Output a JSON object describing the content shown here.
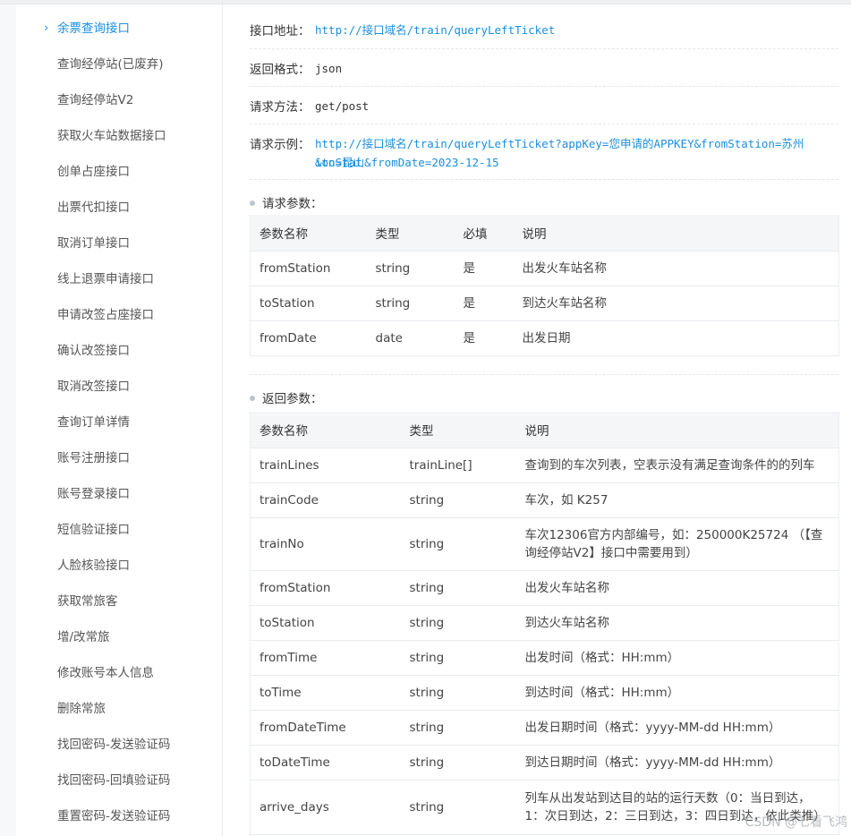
{
  "sidebar": {
    "items": [
      {
        "label": "余票查询接口",
        "active": true
      },
      {
        "label": "查询经停站(已废弃)"
      },
      {
        "label": "查询经停站V2"
      },
      {
        "label": "获取火车站数据接口"
      },
      {
        "label": "创单占座接口"
      },
      {
        "label": "出票代扣接口"
      },
      {
        "label": "取消订单接口"
      },
      {
        "label": "线上退票申请接口"
      },
      {
        "label": "申请改签占座接口"
      },
      {
        "label": "确认改签接口"
      },
      {
        "label": "取消改签接口"
      },
      {
        "label": "查询订单详情"
      },
      {
        "label": "账号注册接口"
      },
      {
        "label": "账号登录接口"
      },
      {
        "label": "短信验证接口"
      },
      {
        "label": "人脸核验接口"
      },
      {
        "label": "获取常旅客"
      },
      {
        "label": "增/改常旅"
      },
      {
        "label": "修改账号本人信息"
      },
      {
        "label": "删除常旅"
      },
      {
        "label": "找回密码-发送验证码"
      },
      {
        "label": "找回密码-回填验证码"
      },
      {
        "label": "重置密码-发送验证码"
      }
    ]
  },
  "info": {
    "address_label": "接口地址：",
    "address_value": "http://接口域名/train/queryLeftTicket",
    "format_label": "返回格式：",
    "format_value": "json",
    "method_label": "请求方法：",
    "method_value": "get/post",
    "example_label": "请求示例：",
    "example_line1": "http://接口域名/train/queryLeftTicket?appKey=您申请的APPKEY&fromStation=苏州&toStat",
    "example_line2": "ion=昆山&fromDate=2023-12-15"
  },
  "request_params": {
    "title": "请求参数：",
    "headers": [
      "参数名称",
      "类型",
      "必填",
      "说明"
    ],
    "rows": [
      [
        "fromStation",
        "string",
        "是",
        "出发火车站名称"
      ],
      [
        "toStation",
        "string",
        "是",
        "到达火车站名称"
      ],
      [
        "fromDate",
        "date",
        "是",
        "出发日期"
      ]
    ]
  },
  "return_params": {
    "title": "返回参数：",
    "headers": [
      "参数名称",
      "类型",
      "说明"
    ],
    "rows": [
      [
        "trainLines",
        "trainLine[]",
        "查询到的车次列表，空表示没有满足查询条件的的列车"
      ],
      [
        "trainCode",
        "string",
        "车次，如 K257"
      ],
      [
        "trainNo",
        "string",
        "车次12306官方内部编号，如：250000K25724 （【查询经停站V2】接口中需要用到）"
      ],
      [
        "fromStation",
        "string",
        "出发火车站名称"
      ],
      [
        "toStation",
        "string",
        "到达火车站名称"
      ],
      [
        "fromTime",
        "string",
        "出发时间（格式：HH:mm）"
      ],
      [
        "toTime",
        "string",
        "到达时间（格式：HH:mm）"
      ],
      [
        "fromDateTime",
        "string",
        "出发日期时间（格式：yyyy-MM-dd HH:mm）"
      ],
      [
        "toDateTime",
        "string",
        "到达日期时间（格式：yyyy-MM-dd HH:mm）"
      ],
      [
        "arrive_days",
        "string",
        "列车从出发站到达目的站的运行天数（0：当日到达，1：次日到达，2：三日到达，3：四日到达，依此类推）"
      ]
    ]
  },
  "watermark": "CSDN @七看飞鸿",
  "colors": {
    "accent": "#1a8fe0",
    "header_bg": "#f4f6f8",
    "border": "#e8ebef"
  }
}
